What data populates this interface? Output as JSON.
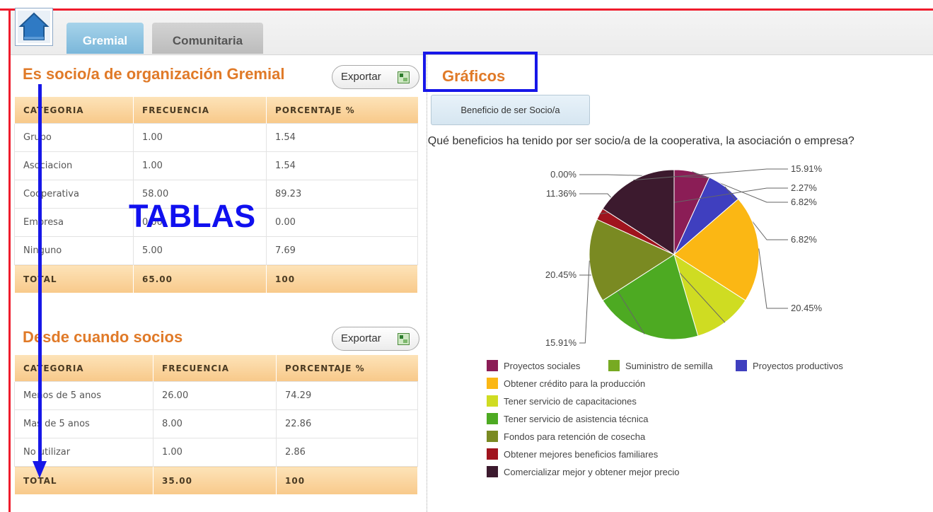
{
  "tabs": {
    "gremial": "Gremial",
    "comunitaria": "Comunitaria"
  },
  "sections": [
    {
      "title": "Es socio/a de organización Gremial",
      "export_label": "Exportar",
      "headers": [
        "CATEGORIA",
        "FRECUENCIA",
        "PORCENTAJE %"
      ],
      "rows": [
        [
          "Grupo",
          "1.00",
          "1.54"
        ],
        [
          "Asociacion",
          "1.00",
          "1.54"
        ],
        [
          "Cooperativa",
          "58.00",
          "89.23"
        ],
        [
          "Empresa",
          "0.00",
          "0.00"
        ],
        [
          "Ninguno",
          "5.00",
          "7.69"
        ]
      ],
      "total": [
        "TOTAL",
        "65.00",
        "100"
      ]
    },
    {
      "title": "Desde cuando socios",
      "export_label": "Exportar",
      "headers": [
        "CATEGORIA",
        "FRECUENCIA",
        "PORCENTAJE %"
      ],
      "rows": [
        [
          "Menos de 5 anos",
          "26.00",
          "74.29"
        ],
        [
          "Mas de 5 anos",
          "8.00",
          "22.86"
        ],
        [
          "No utilizar",
          "1.00",
          "2.86"
        ]
      ],
      "total": [
        "TOTAL",
        "35.00",
        "100"
      ]
    }
  ],
  "annotation_label": "TABLAS",
  "graficos": {
    "title": "Gráficos",
    "button_label": "Beneficio de ser Socio/a"
  },
  "chart_data": {
    "type": "pie",
    "title": "¿Qué beneficios ha tenido por ser socio/a de la cooperativa, la asociación o empresa?",
    "series": [
      {
        "name": "Proyectos sociales",
        "value": 6.82,
        "label": "6.82%",
        "color": "#8b1d56"
      },
      {
        "name": "Suministro de semilla",
        "value": 0.0,
        "label": "0.00%",
        "color": "#77aa22"
      },
      {
        "name": "Proyectos productivos",
        "value": 6.82,
        "label": "6.82%",
        "color": "#3f3fbf"
      },
      {
        "name": "Obtener crédito para la producción",
        "value": 20.45,
        "label": "20.45%",
        "color": "#fbb714"
      },
      {
        "name": "Tener servicio de capacitaciones",
        "value": 11.36,
        "label": "11.36%",
        "color": "#cfdc22"
      },
      {
        "name": "Tener servicio de asistencia técnica",
        "value": 20.45,
        "label": "20.45%",
        "color": "#4daa22"
      },
      {
        "name": "Fondos para retención de cosecha",
        "value": 15.91,
        "label": "15.91%",
        "color": "#7a8a22"
      },
      {
        "name": "Obtener mejores beneficios familiares",
        "value": 2.27,
        "label": "2.27%",
        "color": "#a0141e"
      },
      {
        "name": "Comercializar mejor y obtener mejor precio",
        "value": 15.91,
        "label": "15.91%",
        "color": "#3c1a2e"
      }
    ],
    "legend_position": "bottom"
  }
}
